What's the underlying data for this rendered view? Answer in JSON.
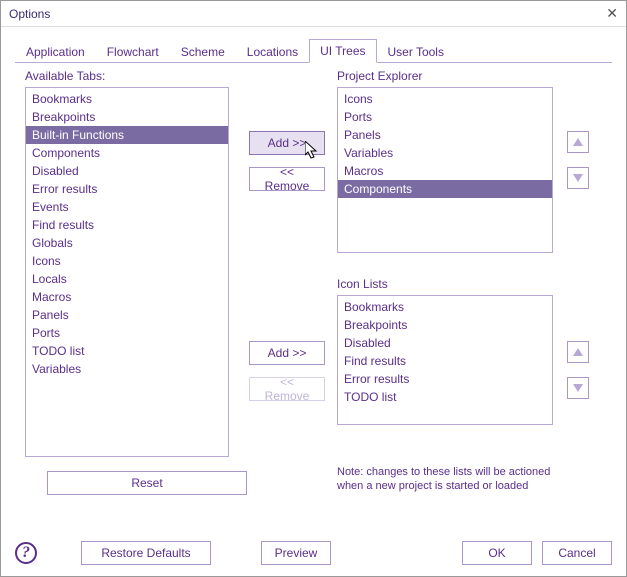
{
  "window": {
    "title": "Options"
  },
  "tabs": {
    "items": [
      "Application",
      "Flowchart",
      "Scheme",
      "Locations",
      "UI Trees",
      "User Tools"
    ],
    "selected_index": 4
  },
  "available": {
    "label": "Available Tabs:",
    "items": [
      "Bookmarks",
      "Breakpoints",
      "Built-in Functions",
      "Components",
      "Disabled",
      "Error results",
      "Events",
      "Find results",
      "Globals",
      "Icons",
      "Locals",
      "Macros",
      "Panels",
      "Ports",
      "TODO list",
      "Variables"
    ],
    "selected_index": 2
  },
  "project_explorer": {
    "label": "Project Explorer",
    "items": [
      "Icons",
      "Ports",
      "Panels",
      "Variables",
      "Macros",
      "Components"
    ],
    "selected_index": 5
  },
  "icon_lists": {
    "label": "Icon Lists",
    "items": [
      "Bookmarks",
      "Breakpoints",
      "Disabled",
      "Find results",
      "Error results",
      "TODO list"
    ]
  },
  "buttons": {
    "add1": "Add >>",
    "remove1": "<< Remove",
    "add2": "Add >>",
    "remove2": "<< Remove",
    "reset": "Reset",
    "restore_defaults": "Restore Defaults",
    "preview": "Preview",
    "ok": "OK",
    "cancel": "Cancel"
  },
  "note": {
    "line1": "Note: changes to these lists will be actioned",
    "line2": "when a new project is started or loaded"
  }
}
